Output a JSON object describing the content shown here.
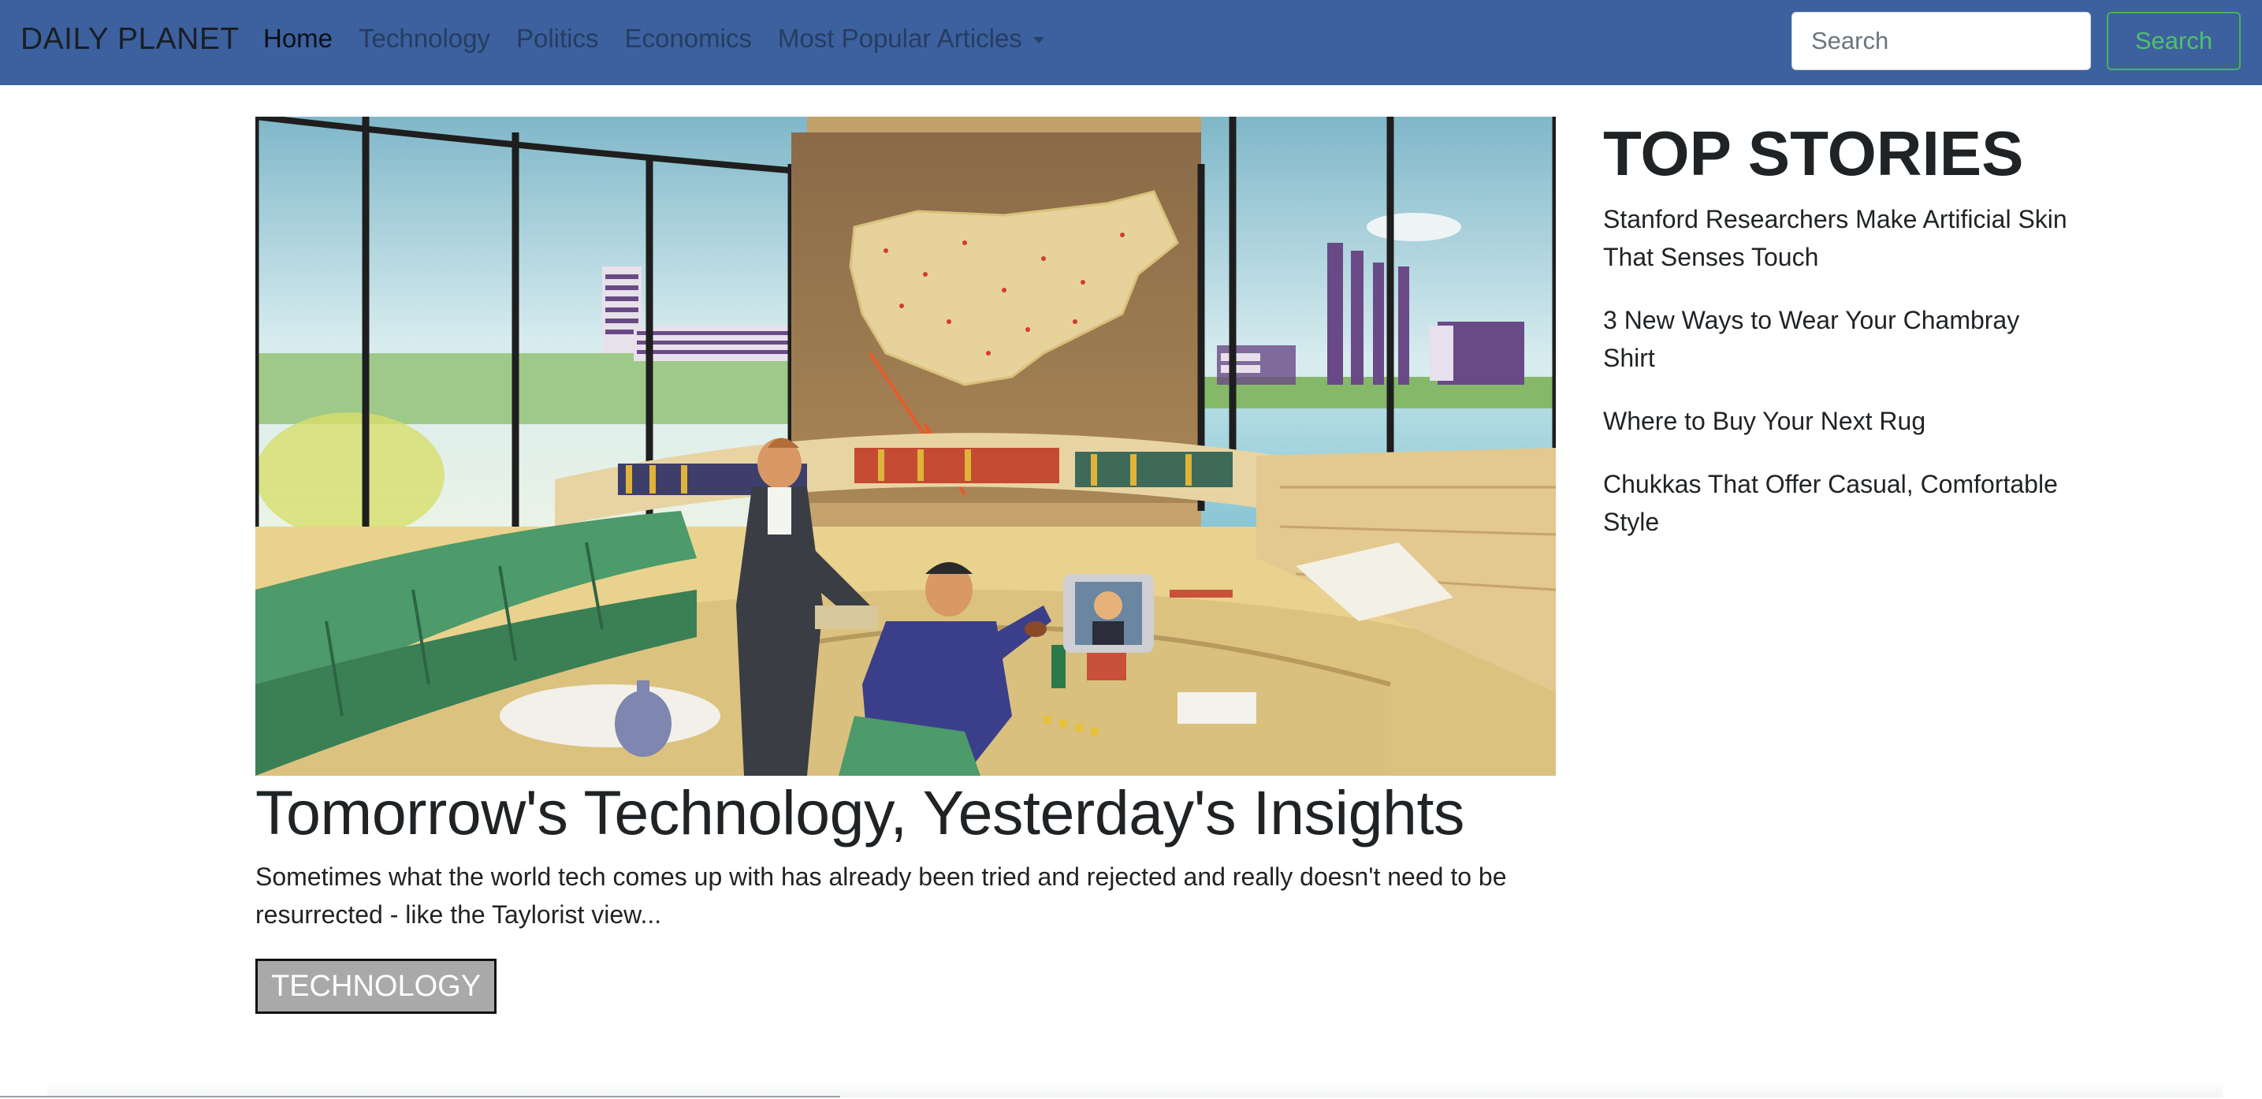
{
  "navbar": {
    "brand": "DAILY PLANET",
    "links": [
      {
        "label": "Home",
        "active": true
      },
      {
        "label": "Technology",
        "active": false
      },
      {
        "label": "Politics",
        "active": false
      },
      {
        "label": "Economics",
        "active": false
      },
      {
        "label": "Most Popular Articles",
        "active": false,
        "dropdown": true
      }
    ],
    "search_placeholder": "Search",
    "search_button": "Search",
    "colors": {
      "background": "#3c619e",
      "search_button": "#52c06a"
    }
  },
  "feature": {
    "headline": "Tomorrow's Technology, Yesterday's Insights",
    "excerpt": "Sometimes what the world tech comes up with has already been tried and rejected and really doesn't need to be resurrected - like the Taylorist view...",
    "category": "TECHNOLOGY"
  },
  "sidebar": {
    "title": "TOP STORIES",
    "stories": [
      {
        "title": "Stanford Researchers Make Artificial Skin That Senses Touch"
      },
      {
        "title": "3 New Ways to Wear Your Chambray Shirt"
      },
      {
        "title": "Where to Buy Your Next Rug"
      },
      {
        "title": "Chukkas That Offer Casual, Comfortable Style"
      }
    ]
  }
}
